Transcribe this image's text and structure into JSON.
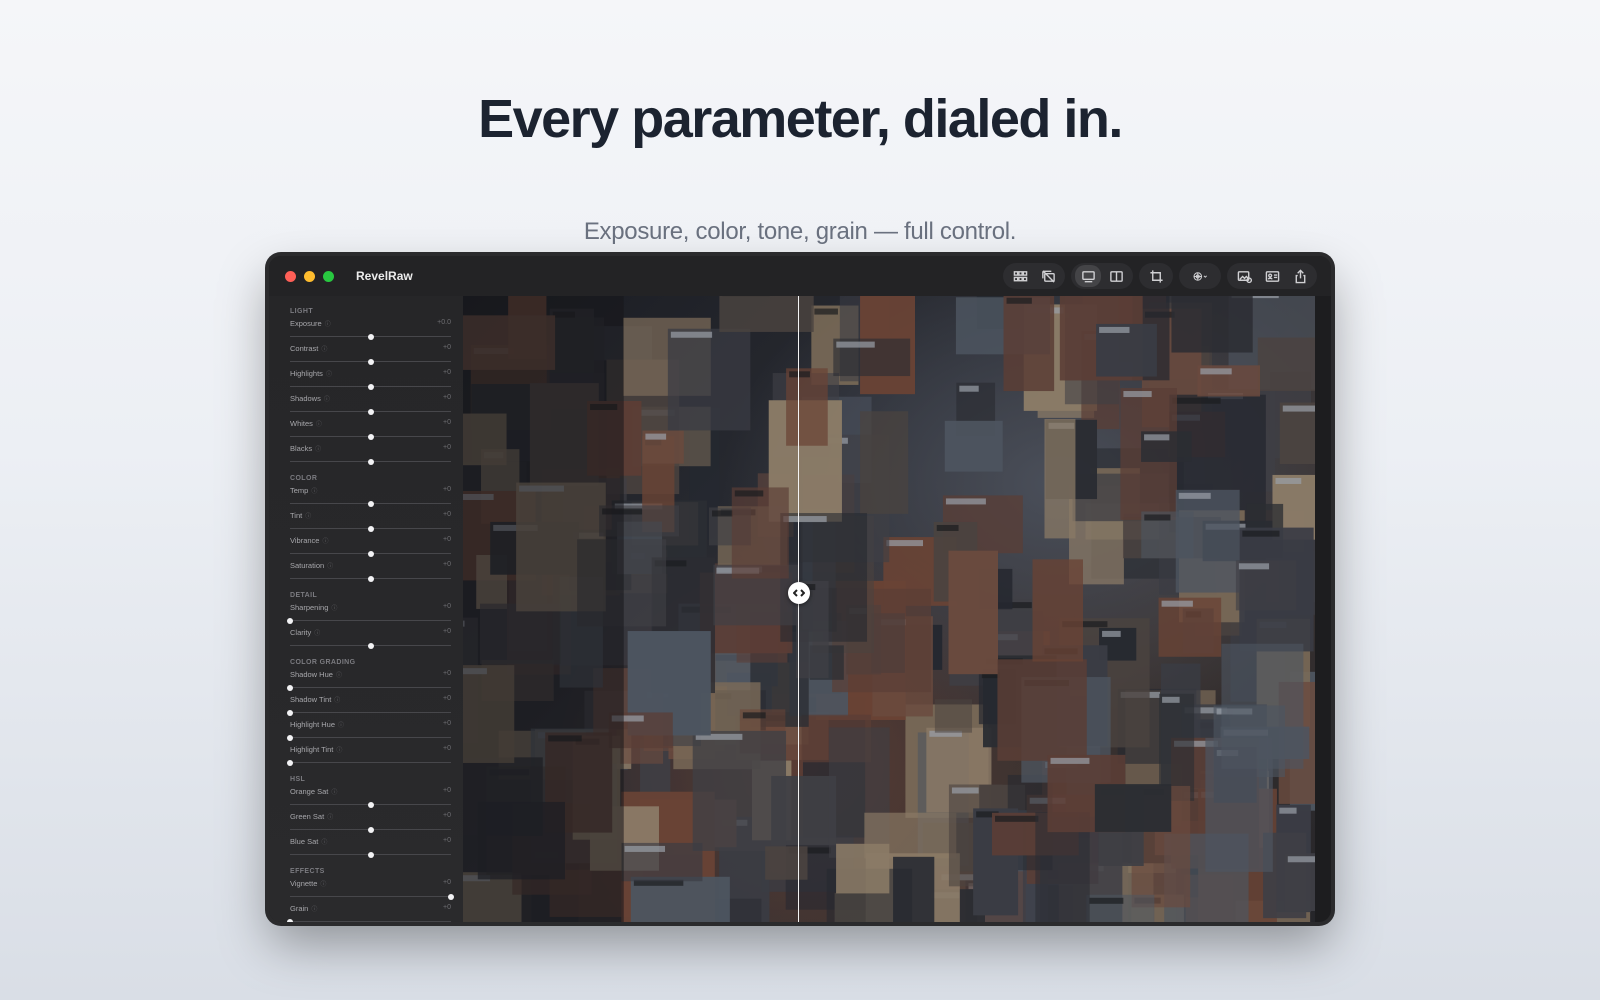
{
  "hero": {
    "headline": "Every parameter, dialed in.",
    "subhead": "Exposure, color, tone, grain — full control."
  },
  "window": {
    "title": "RevelRaw",
    "toolbar_icons": [
      "grid-icon",
      "compare-photos-icon",
      "single-view-icon",
      "split-view-icon",
      "crop-icon",
      "filter-menu-icon",
      "add-photo-icon",
      "info-card-icon",
      "share-icon"
    ]
  },
  "colors": {
    "accent_red": "#fe5f57",
    "accent_yellow": "#febc2e",
    "accent_green": "#28c840",
    "panel_bg": "#262628",
    "headline": "#1c2330"
  },
  "sidebar": {
    "sections": [
      {
        "title": "LIGHT",
        "params": [
          {
            "label": "Exposure",
            "value": "+0.0",
            "level": 0.5
          },
          {
            "label": "Contrast",
            "value": "+0",
            "level": 0.5
          },
          {
            "label": "Highlights",
            "value": "+0",
            "level": 0.5
          },
          {
            "label": "Shadows",
            "value": "+0",
            "level": 0.5
          },
          {
            "label": "Whites",
            "value": "+0",
            "level": 0.5
          },
          {
            "label": "Blacks",
            "value": "+0",
            "level": 0.5
          }
        ]
      },
      {
        "title": "COLOR",
        "params": [
          {
            "label": "Temp",
            "value": "+0",
            "level": 0.5
          },
          {
            "label": "Tint",
            "value": "+0",
            "level": 0.5
          },
          {
            "label": "Vibrance",
            "value": "+0",
            "level": 0.5
          },
          {
            "label": "Saturation",
            "value": "+0",
            "level": 0.5
          }
        ]
      },
      {
        "title": "DETAIL",
        "params": [
          {
            "label": "Sharpening",
            "value": "+0",
            "level": 0.0
          },
          {
            "label": "Clarity",
            "value": "+0",
            "level": 0.5
          }
        ]
      },
      {
        "title": "COLOR GRADING",
        "params": [
          {
            "label": "Shadow Hue",
            "value": "+0",
            "level": 0.0
          },
          {
            "label": "Shadow Tint",
            "value": "+0",
            "level": 0.0
          },
          {
            "label": "Highlight Hue",
            "value": "+0",
            "level": 0.0
          },
          {
            "label": "Highlight Tint",
            "value": "+0",
            "level": 0.0
          }
        ]
      },
      {
        "title": "HSL",
        "params": [
          {
            "label": "Orange Sat",
            "value": "+0",
            "level": 0.5
          },
          {
            "label": "Green Sat",
            "value": "+0",
            "level": 0.5
          },
          {
            "label": "Blue Sat",
            "value": "+0",
            "level": 0.5
          }
        ]
      },
      {
        "title": "EFFECTS",
        "params": [
          {
            "label": "Vignette",
            "value": "+0",
            "level": 1.0
          },
          {
            "label": "Grain",
            "value": "+0",
            "level": 0.0
          }
        ]
      }
    ]
  },
  "viewer": {
    "split_position": 0.393,
    "handle_position": 0.475
  }
}
